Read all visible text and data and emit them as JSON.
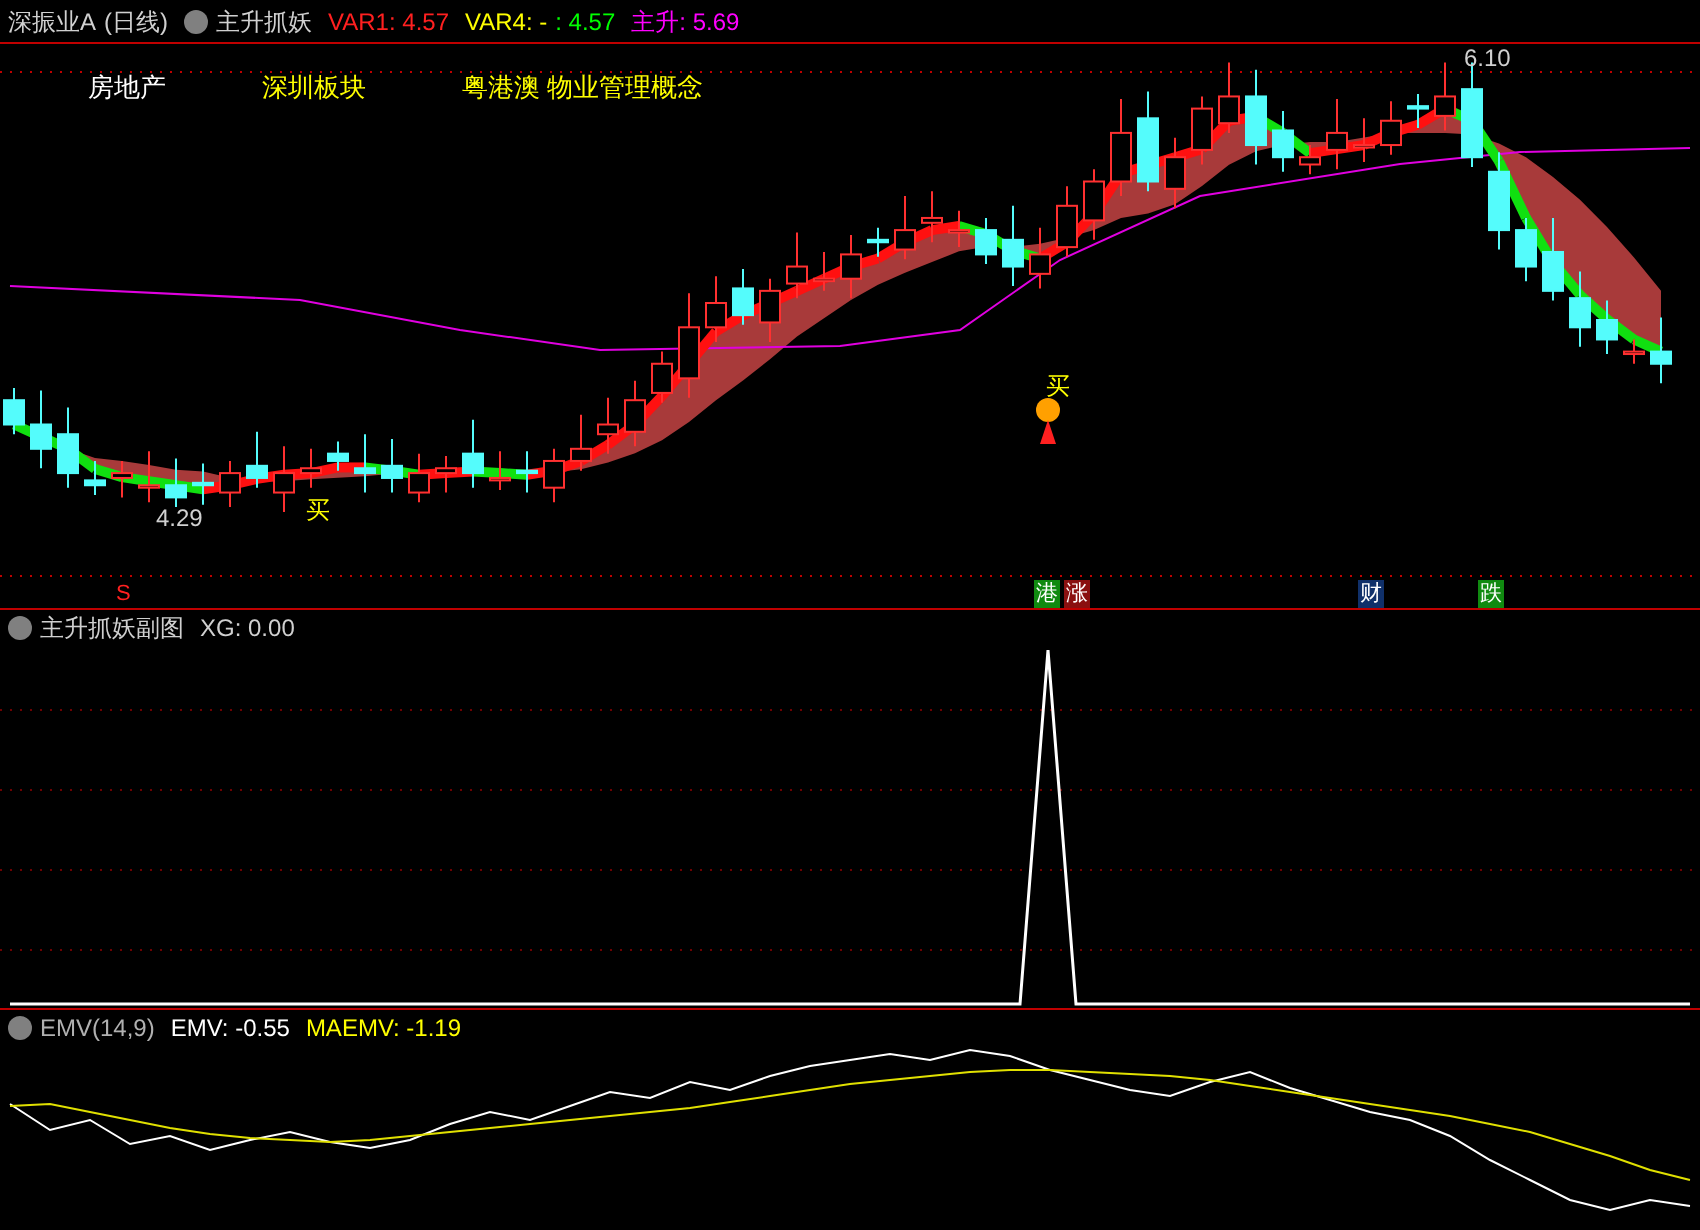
{
  "main_panel": {
    "stock": "深振业A",
    "period": "(日线)",
    "indicator": "主升抓妖",
    "readings": [
      {
        "text": "VAR1: 4.57",
        "color": "#ff2020"
      },
      {
        "text": "VAR4: -",
        "color": "#ffff00"
      },
      {
        "text": ": 4.57",
        "color": "#00ff00"
      },
      {
        "text": "主升: 5.69",
        "color": "#ff00ff"
      }
    ],
    "tags": [
      {
        "text": "房地产",
        "color": "#ffffff"
      },
      {
        "text": "深圳板块",
        "color": "#ffff00"
      },
      {
        "text": "粤港澳 物业管理概念",
        "color": "#ffff00"
      }
    ],
    "high_label": "6.10",
    "low_label": "4.29",
    "buy_labels": [
      "买",
      "买"
    ],
    "markers": [
      {
        "text": "S",
        "color": "#ff2020",
        "kind": "letter"
      },
      {
        "text": "港",
        "color": "#108a10",
        "kind": "badge"
      },
      {
        "text": "涨",
        "color": "#8a1010",
        "kind": "badge"
      },
      {
        "text": "财",
        "color": "#10306a",
        "kind": "badge"
      },
      {
        "text": "跌",
        "color": "#108a10",
        "kind": "badge"
      }
    ]
  },
  "sub_panel": {
    "title": "主升抓妖副图",
    "reading": "XG: 0.00"
  },
  "emv_panel": {
    "title": "EMV(14,9)",
    "emv": "EMV: -0.55",
    "maemv": "MAEMV: -1.19"
  }
}
